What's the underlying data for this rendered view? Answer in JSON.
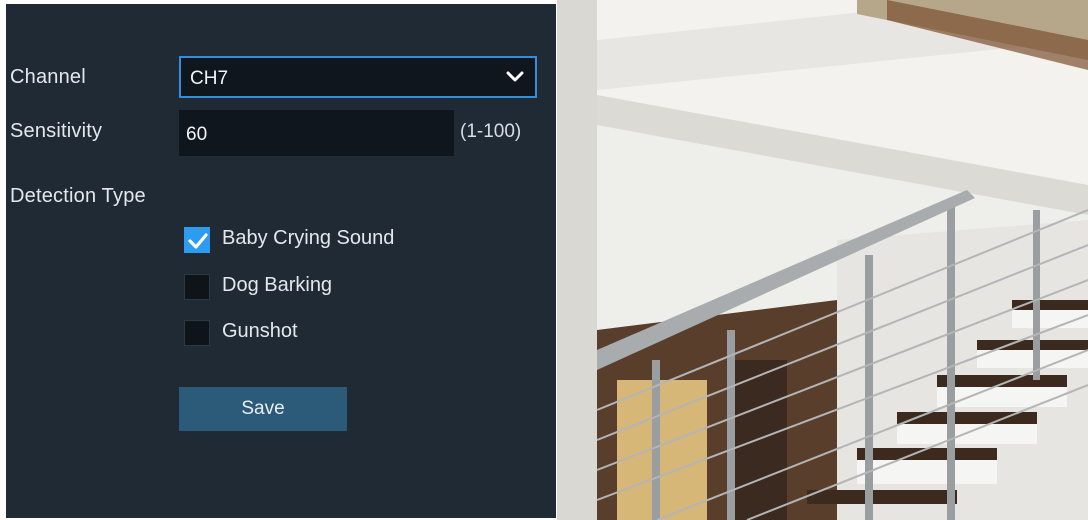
{
  "form": {
    "channel_label": "Channel",
    "channel_value": "CH7",
    "sensitivity_label": "Sensitivity",
    "sensitivity_value": "60",
    "sensitivity_range": "(1-100)",
    "detection_type_label": "Detection Type",
    "detection_options": [
      {
        "label": "Baby Crying Sound",
        "checked": true
      },
      {
        "label": "Dog Barking",
        "checked": false
      },
      {
        "label": "Gunshot",
        "checked": false
      }
    ],
    "save_label": "Save"
  },
  "colors": {
    "panel_bg": "#1f2a35",
    "field_bg": "#0f161d",
    "accent": "#2d9cf0",
    "button_bg": "#2c5a79"
  },
  "icons": {
    "dropdown": "chevron-down-icon",
    "check": "checkmark-icon"
  }
}
